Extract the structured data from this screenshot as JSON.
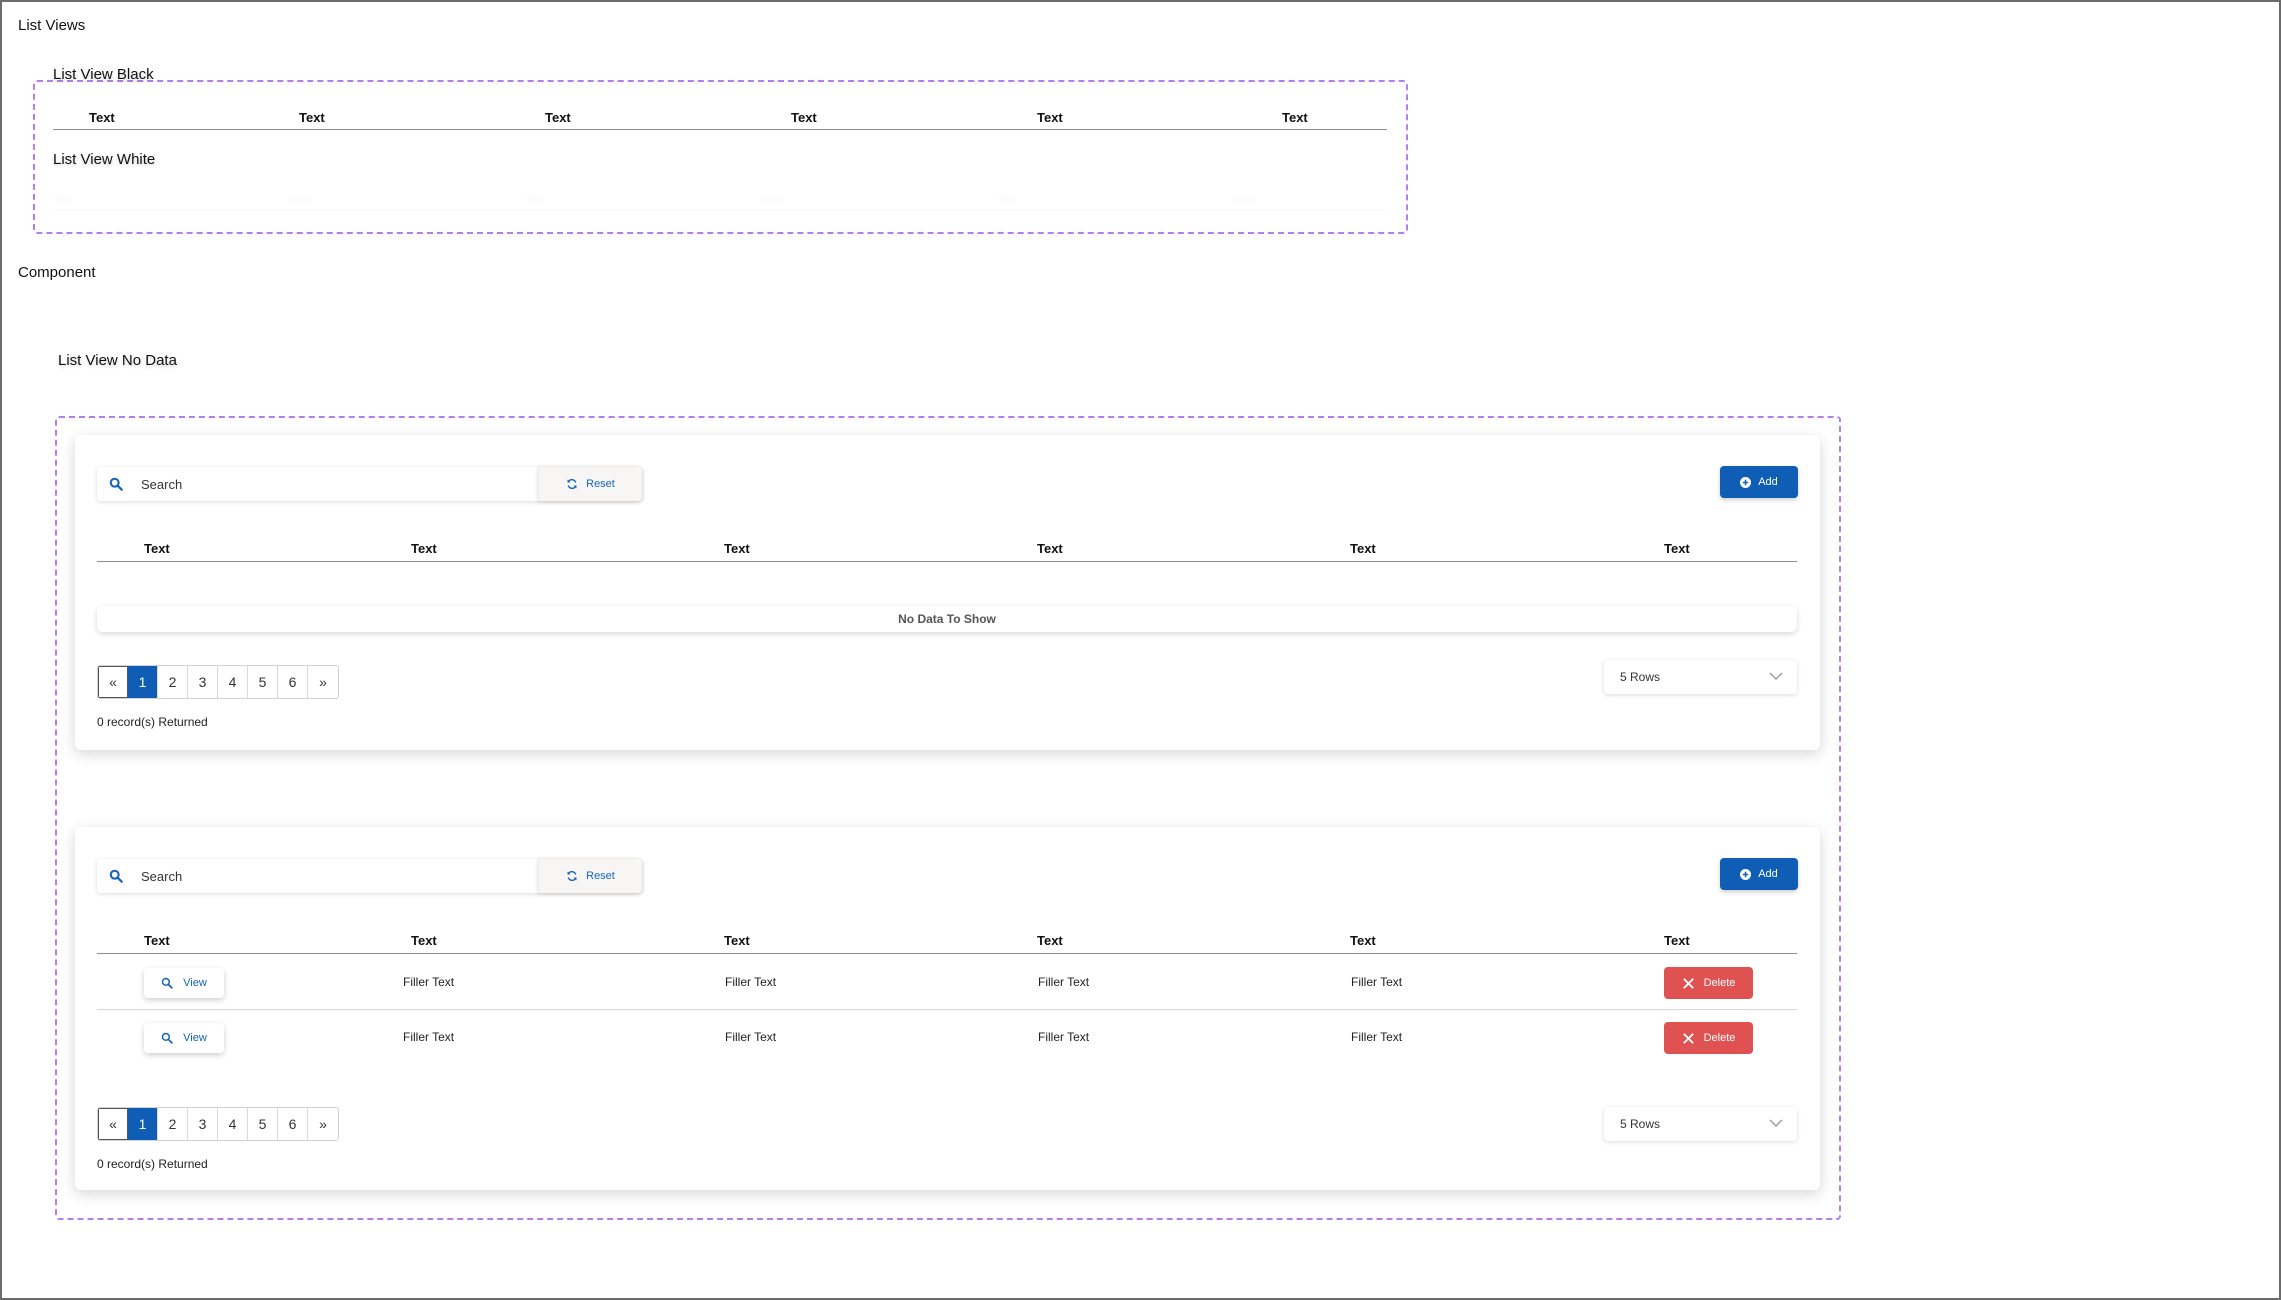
{
  "page": {
    "list_views_title": "List Views",
    "list_view_black_label": "List View Black",
    "list_view_white_label": "List View White",
    "component_title": "Component",
    "no_data_label": "List View No Data"
  },
  "list_view_black": {
    "columns": [
      "Text",
      "Text",
      "Text",
      "Text",
      "Text",
      "Text"
    ]
  },
  "list_view_white": {
    "columns": [
      "Text",
      "Text",
      "Text",
      "Text",
      "Text",
      "Text"
    ]
  },
  "toolbar": {
    "search_placeholder": "Search",
    "reset_label": "Reset",
    "add_label": "Add"
  },
  "table": {
    "columns": [
      "Text",
      "Text",
      "Text",
      "Text",
      "Text",
      "Text"
    ]
  },
  "empty_table": {
    "message": "No Data To Show"
  },
  "data_table": {
    "view_label": "View",
    "delete_label": "Delete",
    "rows": [
      [
        "Filler Text",
        "Filler Text",
        "Filler Text",
        "Filler Text"
      ],
      [
        "Filler Text",
        "Filler Text",
        "Filler Text",
        "Filler Text"
      ]
    ]
  },
  "pagination": {
    "first": "«",
    "pages": [
      "1",
      "2",
      "3",
      "4",
      "5",
      "6"
    ],
    "last": "»",
    "active_page": "1",
    "records_text": "0 record(s) Returned"
  },
  "rows_select": {
    "value": "5 Rows"
  },
  "colors": {
    "primary": "#0f5db5",
    "danger": "#e05252",
    "dashed_border": "#b57ef0"
  },
  "icons": {
    "search": "search-icon",
    "reset": "refresh-icon",
    "add": "plus-circle-icon",
    "view": "search-icon",
    "delete": "close-icon",
    "rows_select": "chevron-down-icon"
  }
}
